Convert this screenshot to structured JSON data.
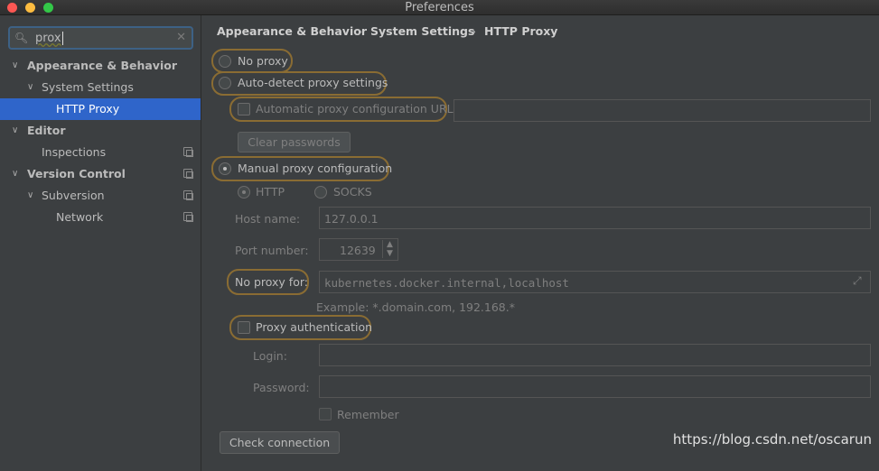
{
  "window": {
    "title": "Preferences"
  },
  "traffic_lights": {
    "close_color": "#fc5753",
    "minimize_color": "#fdbc40",
    "zoom_color": "#33c748"
  },
  "search": {
    "value": "prox",
    "icon": "search-icon"
  },
  "tree": [
    {
      "label": "Appearance & Behavior",
      "expanded": true
    },
    {
      "label": "System Settings",
      "expanded": true
    },
    {
      "label": "HTTP Proxy",
      "selected": true
    },
    {
      "label": "Editor",
      "expanded": true
    },
    {
      "label": "Inspections"
    },
    {
      "label": "Version Control",
      "expanded": true
    },
    {
      "label": "Subversion",
      "expanded": true
    },
    {
      "label": "Network"
    }
  ],
  "breadcrumb": [
    "Appearance & Behavior",
    "System Settings",
    "HTTP Proxy"
  ],
  "proxy": {
    "no_proxy": "No proxy",
    "auto_detect": "Auto-detect proxy settings",
    "auto_config_url": "Automatic proxy configuration URL:",
    "clear_passwords": "Clear passwords",
    "manual": "Manual proxy configuration",
    "http": "HTTP",
    "socks": "SOCKS",
    "host_label": "Host name:",
    "host_value": "127.0.0.1",
    "port_label": "Port number:",
    "port_value": "12639",
    "no_proxy_for_label": "No proxy for:",
    "no_proxy_for_value": "kubernetes.docker.internal,localhost",
    "example": "Example: *.domain.com, 192.168.*",
    "auth": "Proxy authentication",
    "login_label": "Login:",
    "password_label": "Password:",
    "remember": "Remember",
    "check_connection": "Check connection"
  },
  "highlight_color": "#8a6c33",
  "selection_color": "#2f65ca",
  "watermark": "https://blog.csdn.net/oscarun"
}
